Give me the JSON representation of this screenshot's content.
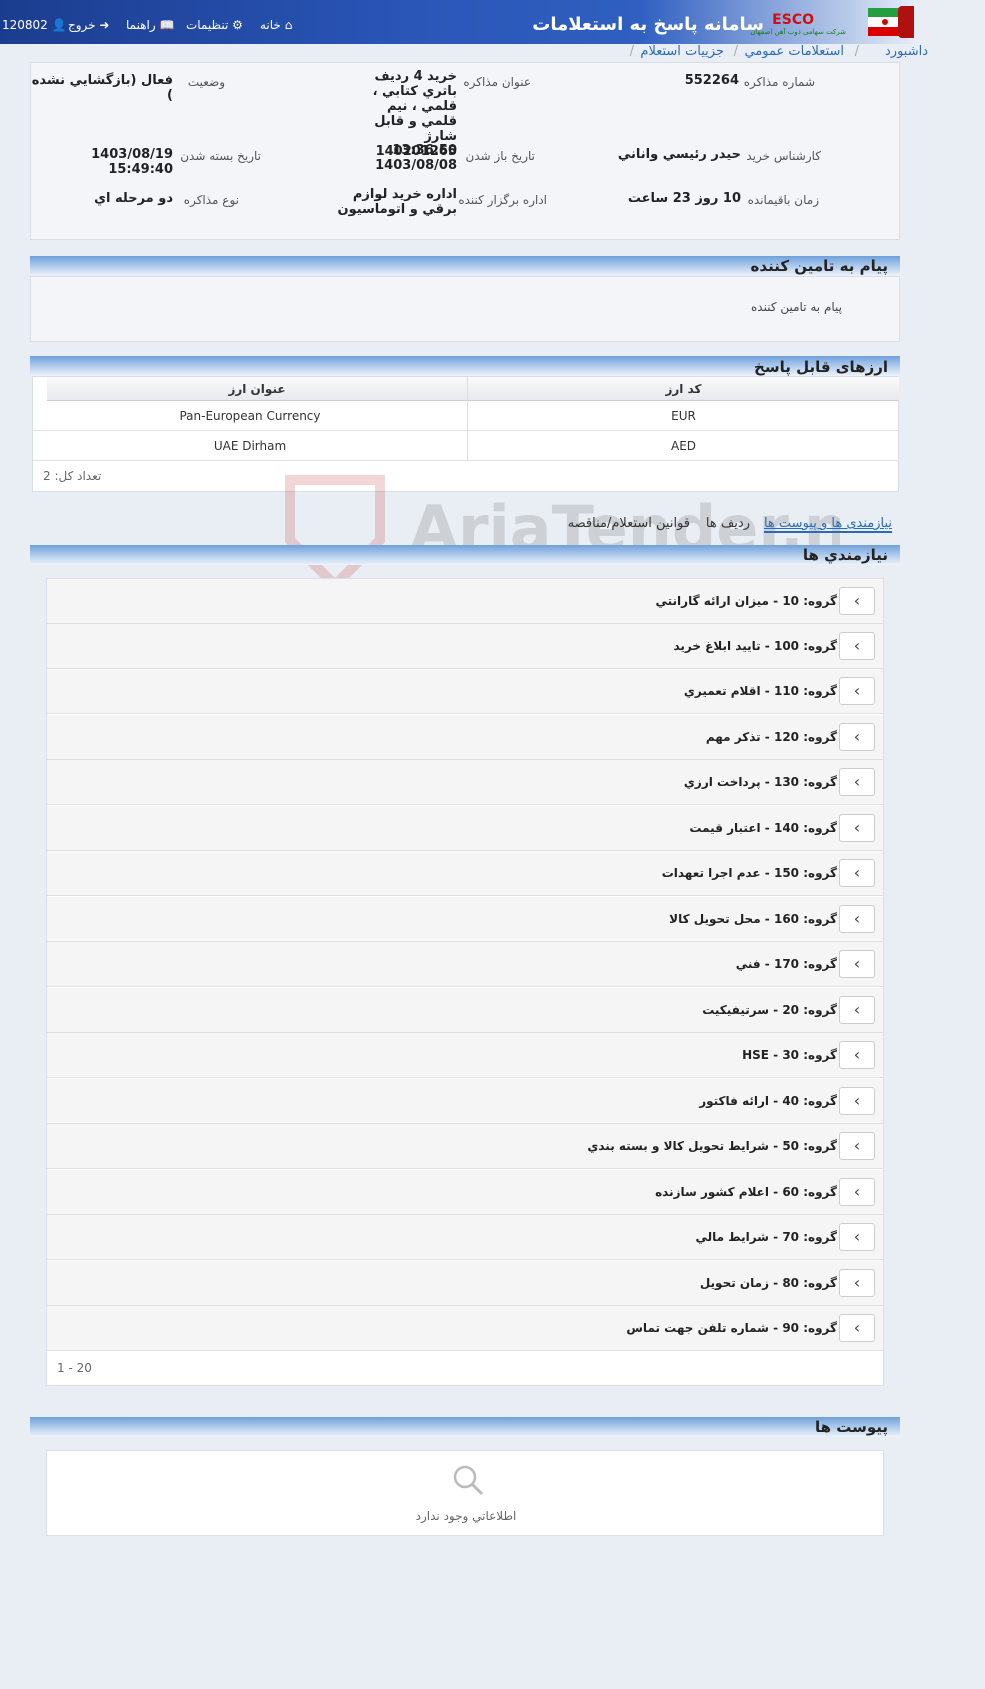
{
  "header": {
    "user_id": "120802",
    "nav": {
      "logout": "خروج",
      "help": "راهنما",
      "settings": "تنظیمات",
      "home": "خانه"
    },
    "app_title": "سامانه پاسخ به استعلامات",
    "brand": "ESCO",
    "brand_sub": "شرکت سهامی ذوب آهن اصفهان"
  },
  "breadcrumb": {
    "dashboard": "داشبورد",
    "public": "استعلامات عمومي",
    "details": "جزييات استعلام"
  },
  "info": {
    "number_label": "شماره مذاکره",
    "number": "552264",
    "title_label": "عنوان مذاکره",
    "title": "خريد 4 رديف باتري کتابي ، قلمي ، نيم قلمي و قابل شارژ 140201265",
    "status_label": "وضعيت",
    "status": "فعال (بازگشايي نشده )",
    "expert_label": "کارشناس خريد",
    "expert": "حيدر رئيسي واناني",
    "open_label": "تاريخ باز شدن",
    "open_time": "13:36:50",
    "open_date": "1403/08/08",
    "close_label": "تاريخ بسته شدن",
    "close": "1403/08/19 15:49:40",
    "remaining_label": "زمان باقيمانده",
    "remaining": "10 روز 23 ساعت",
    "dept_label": "اداره برگزار کننده",
    "dept": "اداره خريد لوازم برقي و اتوماسيون",
    "type_label": "نوع مذاکره",
    "type": "دو مرحله اي"
  },
  "message": {
    "title": "پیام به تامین کننده",
    "text": "پیام به تامین کننده"
  },
  "currencies": {
    "title": "ارزهای قابل پاسخ",
    "col_code": "کد ارز",
    "col_name": "عنوان ارز",
    "rows": [
      {
        "code": "EUR",
        "name": "Pan-European Currency"
      },
      {
        "code": "AED",
        "name": "UAE Dirham"
      }
    ],
    "count": "تعداد کل: 2"
  },
  "tabs": {
    "needs": "نیازمندی ها و پیوست ها",
    "rows": "رديف ها",
    "rules": "قوانين استعلام/مناقصه"
  },
  "requirements": {
    "title": "نيازمندي ها",
    "groups": [
      "گروه: 10 - ميزان ارائه گارانتي",
      "گروه: 100 - تاييد ابلاغ خريد",
      "گروه: 110 - اقلام تعميري",
      "گروه: 120 - تذکر مهم",
      "گروه: 130 - پرداخت ارزي",
      "گروه: 140 - اعتبار قيمت",
      "گروه: 150 - عدم اجرا تعهدات",
      "گروه: 160 - محل تحويل کالا",
      "گروه: 170 - فني",
      "گروه: 20 - سرتيفيکيت",
      "گروه: 30 - HSE",
      "گروه: 40 - ارائه فاکتور",
      "گروه: 50 - شرايط تحويل کالا و بسته بندي",
      "گروه: 60 - اعلام کشور سازنده",
      "گروه: 70 - شرايط مالي",
      "گروه: 80 - زمان تحويل",
      "گروه: 90 - شماره تلفن جهت تماس"
    ],
    "pager": "1 - 20"
  },
  "attachments": {
    "title": "پيوست ها",
    "empty": "اطلاعاتي وجود ندارد"
  },
  "watermark": "AriaTender.neT"
}
